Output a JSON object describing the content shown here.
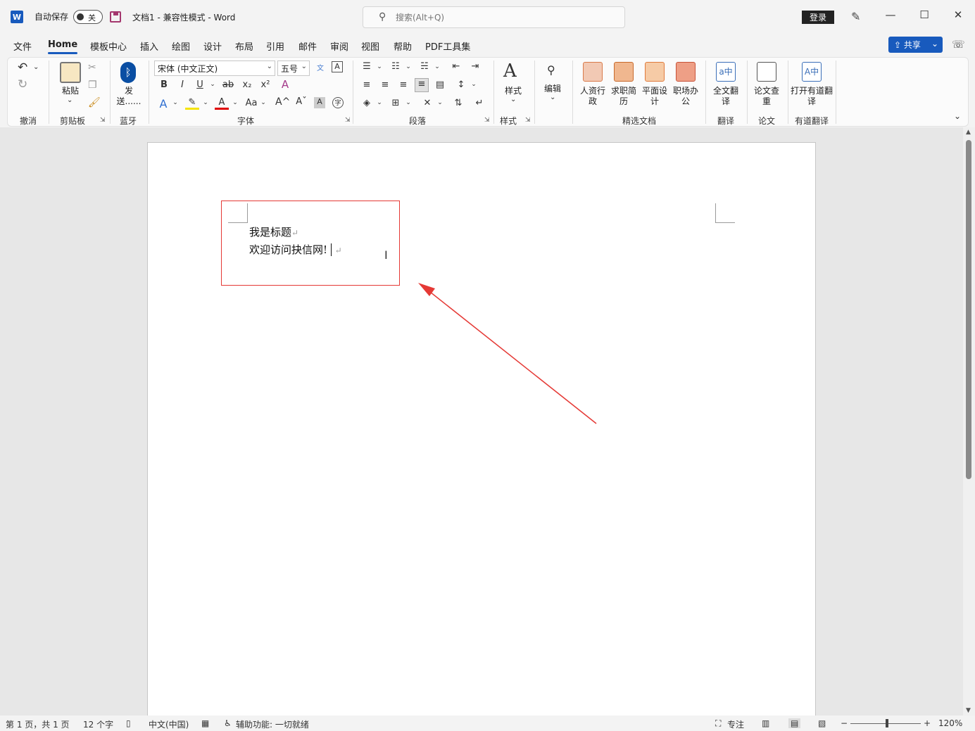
{
  "titlebar": {
    "logo": "W",
    "autosave_label": "自动保存",
    "autosave_state": "关",
    "document_title": "文档1  -  兼容性模式  -  Word",
    "search_placeholder": "搜索(Alt+Q)",
    "login_label": "登录"
  },
  "window_controls": {
    "minimize": "—",
    "maximize": "☐",
    "close": "✕"
  },
  "menu": {
    "tabs": [
      "文件",
      "Home",
      "模板中心",
      "插入",
      "绘图",
      "设计",
      "布局",
      "引用",
      "邮件",
      "审阅",
      "视图",
      "帮助",
      "PDF工具集"
    ],
    "share_label": "共享"
  },
  "ribbon": {
    "groups": {
      "undo": "撤消",
      "clipboard": "剪贴板",
      "bluetooth": "蓝牙",
      "font": "字体",
      "paragraph": "段落",
      "styles": "样式",
      "templates": "精选文档",
      "translate": "翻译",
      "paper": "论文",
      "youdao": "有道翻译"
    },
    "paste_label": "粘贴",
    "send_label": "发送......",
    "font_name": "宋体 (中文正文)",
    "font_size": "五号",
    "styles_label": "样式",
    "edit_label": "编辑",
    "hr_label": "人资行政",
    "resume_label": "求职简历",
    "design_label": "平面设计",
    "office_label": "职场办公",
    "fulltext_label": "全文翻译",
    "papercheck_label": "论文查重",
    "openyoudao_label": "打开有道翻译"
  },
  "document": {
    "line1": "我是标题",
    "line2": "欢迎访问抉信网!",
    "pilcrow": "↵"
  },
  "annotation": {
    "box_color": "#e53935",
    "arrow_color": "#e53935"
  },
  "statusbar": {
    "page": "第 1 页，共 1 页",
    "words": "12 个字",
    "language": "中文(中国)",
    "accessibility": "辅助功能: 一切就绪",
    "focus": "专注",
    "zoom_minus": "−",
    "zoom_plus": "+",
    "zoom": "120%"
  },
  "colors": {
    "accent": "#185abd"
  }
}
